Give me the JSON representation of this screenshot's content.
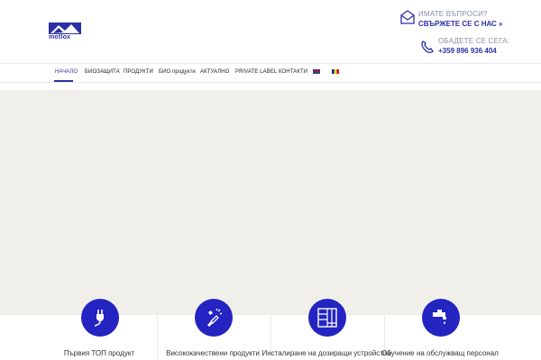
{
  "brand": {
    "logo_text": "motlox",
    "logo_icon": "mountain-logo-icon"
  },
  "contact": {
    "question_line": "ИМАТЕ ВЪПРОСИ?",
    "question_link": "СВЪРЖЕТЕ СЕ С НАС »",
    "call_line": "ОБАДЕТЕ СЕ СЕГА:",
    "phone": "+359 896 936 404"
  },
  "nav": {
    "items": [
      {
        "label": "НАЧАЛО",
        "active": true
      },
      {
        "label": "БИОЗАЩИТА"
      },
      {
        "label": "ПРОДУКТИ"
      },
      {
        "label": "БИО продукти"
      },
      {
        "label": "АКТУАЛНО"
      },
      {
        "label": "PRIVATE LABEL"
      },
      {
        "label": "КОНТАКТИ"
      }
    ],
    "languages": [
      {
        "code": "en",
        "icon": "uk-flag-icon"
      },
      {
        "code": "ro",
        "icon": "romania-flag-icon"
      }
    ]
  },
  "features": [
    {
      "label": "Първия ТОП продукт",
      "icon": "plug-icon"
    },
    {
      "label": "Висококачествени продукти",
      "icon": "spray-paint-icon"
    },
    {
      "label": "Инсталиране на дозиращи устройства",
      "icon": "parquet-icon"
    },
    {
      "label": "Обучение на обслужващ персонал",
      "icon": "faucet-icon"
    }
  ],
  "colors": {
    "accent": "#2b2fa3",
    "feature_circle": "#2424c2",
    "hero_bg": "#f1efea"
  }
}
